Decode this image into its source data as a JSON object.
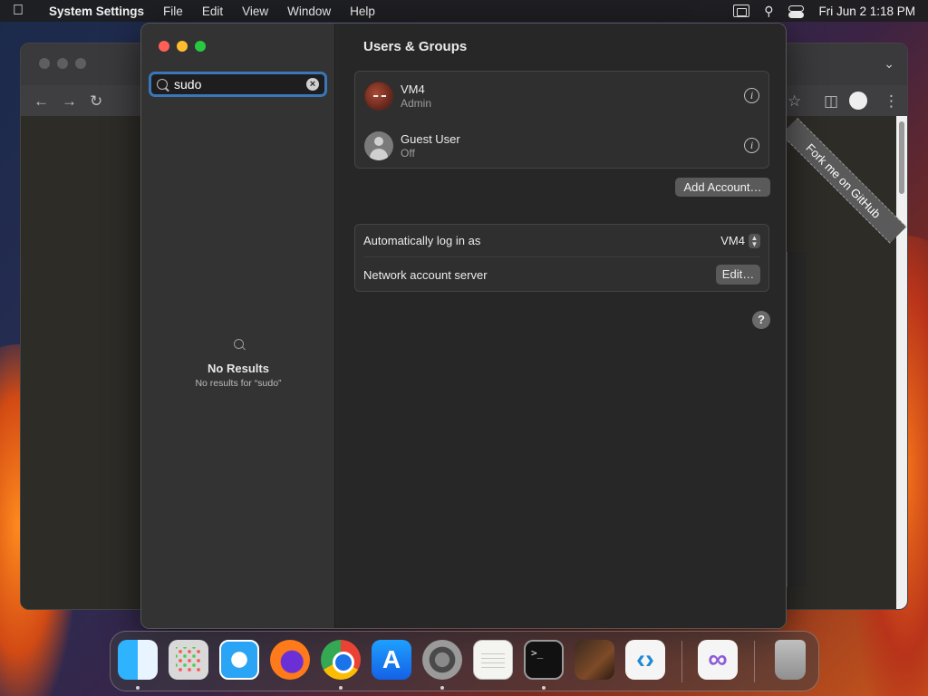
{
  "menubar": {
    "app_name": "System Settings",
    "menus": [
      "File",
      "Edit",
      "View",
      "Window",
      "Help"
    ],
    "clock": "Fri Jun 2  1:18 PM"
  },
  "browser": {
    "ribbon_text": "Fork me on GitHub"
  },
  "sidebar": {
    "search": {
      "value": "sudo"
    },
    "no_results": {
      "title": "No Results",
      "subtitle": "No results for “sudo”"
    }
  },
  "main": {
    "title": "Users & Groups",
    "users": [
      {
        "name": "VM4",
        "role": "Admin"
      },
      {
        "name": "Guest User",
        "role": "Off"
      }
    ],
    "add_account_label": "Add Account…",
    "auto_login": {
      "label": "Automatically log in as",
      "value": "VM4"
    },
    "network_server": {
      "label": "Network account server",
      "button_label": "Edit…"
    },
    "help_label": "?"
  },
  "dock": {
    "apps": [
      "Finder",
      "Launchpad",
      "Safari",
      "Firefox",
      "Google Chrome",
      "App Store",
      "System Settings",
      "TextEdit",
      "Terminal",
      "GarageBand",
      "Visual Studio Code",
      "Visual Studio",
      "Trash"
    ],
    "terminal_glyph": ">_",
    "appstore_glyph": "A",
    "vscode_glyph": "‹›",
    "vs_glyph": "∞"
  },
  "colors": {
    "accent": "#3a76b8",
    "close": "#ff5f57",
    "minimize": "#febc2e",
    "zoom": "#28c840"
  }
}
